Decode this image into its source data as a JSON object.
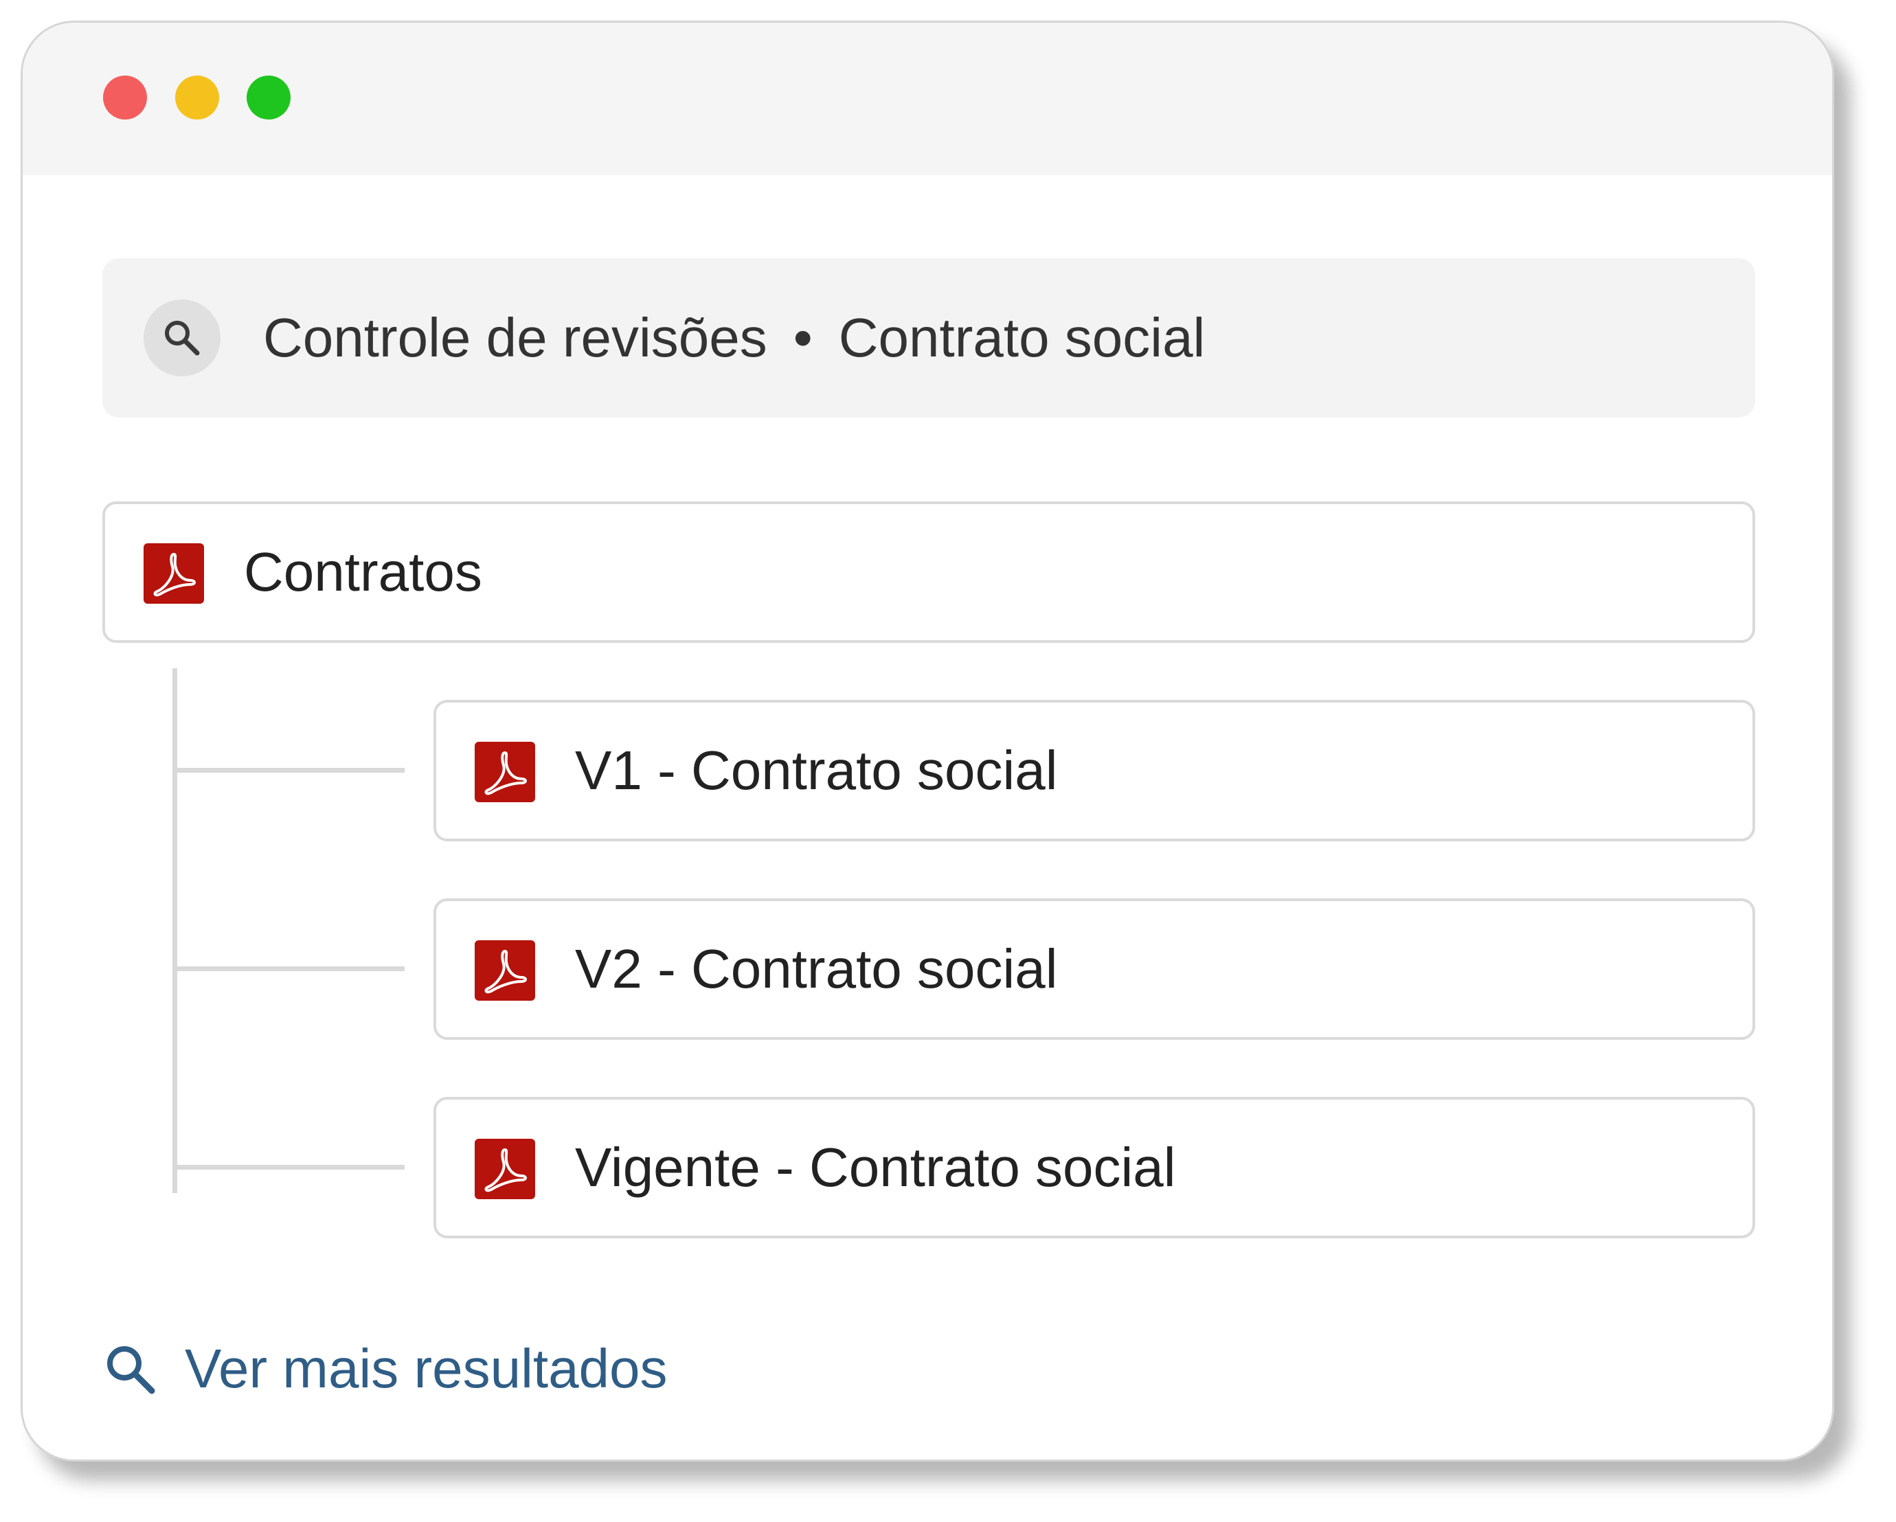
{
  "window": {
    "controls": [
      "close",
      "minimize",
      "maximize"
    ]
  },
  "search": {
    "icon": "search-icon",
    "path_parent": "Controle de revisões",
    "separator": "•",
    "path_current": "Contrato social"
  },
  "results": {
    "root": {
      "icon": "pdf-file-icon",
      "label": "Contratos"
    },
    "children": [
      {
        "icon": "pdf-file-icon",
        "label": "V1 - Contrato social"
      },
      {
        "icon": "pdf-file-icon",
        "label": "V2 - Contrato social"
      },
      {
        "icon": "pdf-file-icon",
        "label": "Vigente - Contrato social"
      }
    ]
  },
  "footer": {
    "icon": "search-icon",
    "more_label": "Ver mais resultados"
  },
  "colors": {
    "close": "#f45d5d",
    "minimize": "#f5c21d",
    "maximize": "#1ec51e",
    "pdf": "#b5130c",
    "link": "#2f5d86"
  }
}
